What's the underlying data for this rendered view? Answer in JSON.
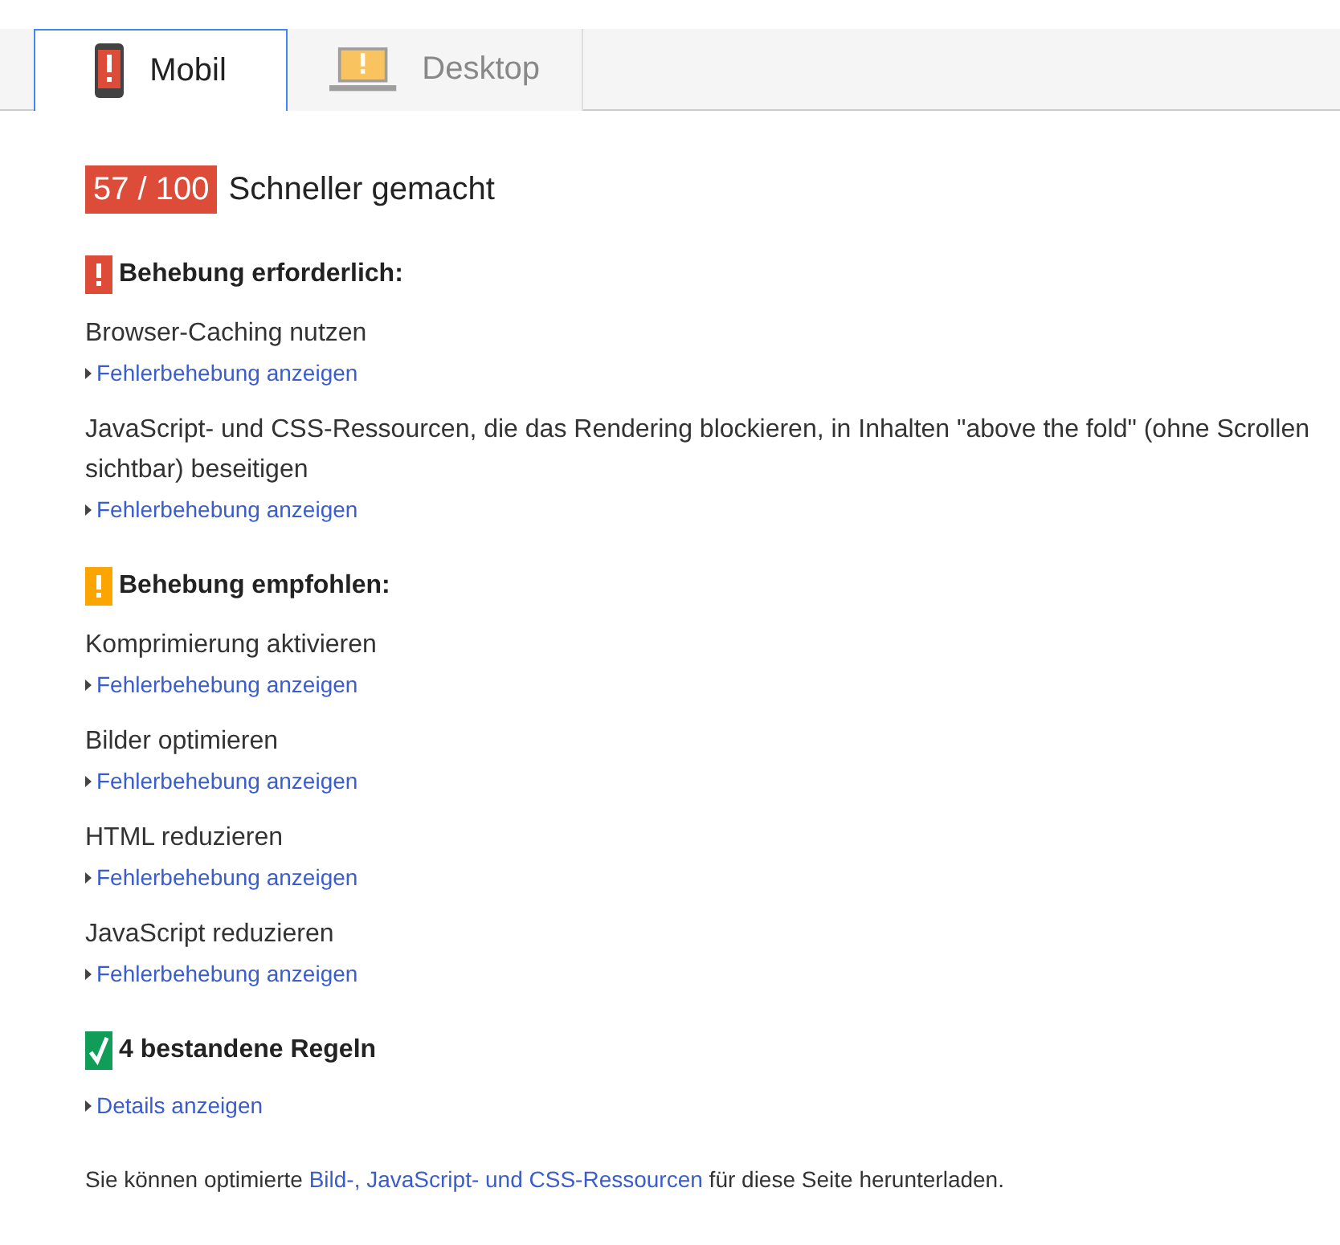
{
  "tabs": [
    {
      "label": "Mobil",
      "kind": "mobile",
      "selected": true
    },
    {
      "label": "Desktop",
      "kind": "desktop",
      "selected": false
    }
  ],
  "score": {
    "value": "57 / 100",
    "label": "Schneller gemacht"
  },
  "sections": [
    {
      "kind": "error",
      "heading": "Behebung erforderlich:",
      "items": [
        {
          "title": "Browser-Caching nutzen",
          "link": "Fehlerbehebung anzeigen"
        },
        {
          "title": "JavaScript- und CSS-Ressourcen, die das Rendering blockieren, in Inhalten \"above the fold\" (ohne Scrollen sichtbar) beseitigen",
          "link": "Fehlerbehebung anzeigen"
        }
      ]
    },
    {
      "kind": "warning",
      "heading": "Behebung empfohlen:",
      "items": [
        {
          "title": "Komprimierung aktivieren",
          "link": "Fehlerbehebung anzeigen"
        },
        {
          "title": "Bilder optimieren",
          "link": "Fehlerbehebung anzeigen"
        },
        {
          "title": "HTML reduzieren",
          "link": "Fehlerbehebung anzeigen"
        },
        {
          "title": "JavaScript reduzieren",
          "link": "Fehlerbehebung anzeigen"
        }
      ]
    },
    {
      "kind": "pass",
      "heading": "4 bestandene Regeln",
      "items": [
        {
          "link": "Details anzeigen"
        }
      ]
    }
  ],
  "footer": {
    "before": "Sie können optimierte ",
    "link": "Bild-, JavaScript- und CSS-Ressourcen",
    "after": " für diese Seite herunterladen."
  }
}
